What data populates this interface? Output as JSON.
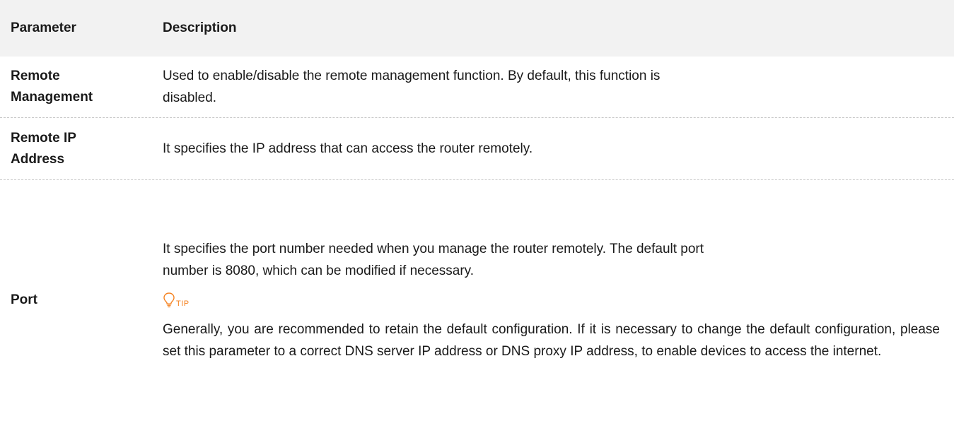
{
  "header": {
    "parameter": "Parameter",
    "description": "Description"
  },
  "rows": [
    {
      "parameter": "Remote Management",
      "parameter_lines": [
        "Remote",
        "Management"
      ],
      "description": "Used to enable/disable the remote management function. By default, this function is disabled.",
      "description_lines": [
        "Used to enable/disable the remote management function. By default, this function is",
        "disabled."
      ]
    },
    {
      "parameter": "Remote IP Address",
      "parameter_lines": [
        "Remote IP",
        "Address"
      ],
      "description": "It specifies the IP address that can access the router remotely."
    },
    {
      "parameter": "Port",
      "description": "It specifies the port number needed when you manage the router remotely. The default port number is 8080, which can be modified if necessary.",
      "description_lines": [
        "It specifies the port number needed when you manage the router remotely. The default port",
        "number is 8080, which can be modified if necessary."
      ],
      "tip": {
        "icon": "lightbulb-icon",
        "label": "TIP",
        "color": "#f58220",
        "text": "Generally, you are recommended to retain the default configuration. If it is necessary to change the default configuration, please set this parameter to a correct DNS server IP address or DNS proxy IP address, to enable devices to access the internet."
      }
    }
  ]
}
